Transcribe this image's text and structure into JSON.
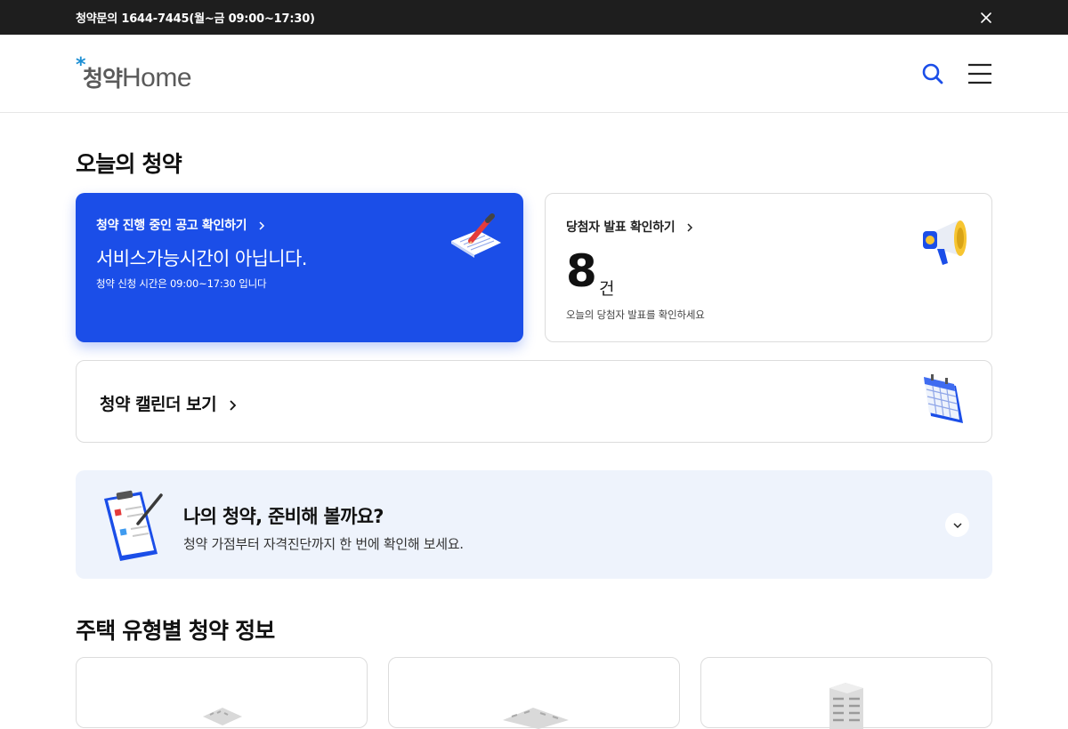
{
  "notice": {
    "text": "청약문의 1644-7445(월~금 09:00~17:30)"
  },
  "logo": {
    "star": "*",
    "kor": "청약",
    "eng": "Home"
  },
  "header": {
    "search_icon": "search-icon",
    "menu_icon": "hamburger-menu-icon"
  },
  "today": {
    "title": "오늘의 청약",
    "ongoing": {
      "link": "청약 진행 중인 공고 확인하기",
      "headline": "서비스가능시간이 아닙니다.",
      "sub": "청약 신청 시간은 09:00~17:30 입니다"
    },
    "winner": {
      "link": "당첨자 발표 확인하기",
      "count": "8",
      "unit": "건",
      "sub": "오늘의 당첨자 발표를 확인하세요"
    },
    "calendar": {
      "label": "청약 캘린더 보기"
    }
  },
  "prep": {
    "title": "나의 청약, 준비해 볼까요?",
    "sub": "청약 가점부터 자격진단까지 한 번에 확인해 보세요."
  },
  "types": {
    "title": "주택 유형별 청약 정보"
  },
  "colors": {
    "accent_blue": "#1b4ee8",
    "logo_star": "#1c8fd4",
    "prep_bg": "#eef3fc"
  }
}
